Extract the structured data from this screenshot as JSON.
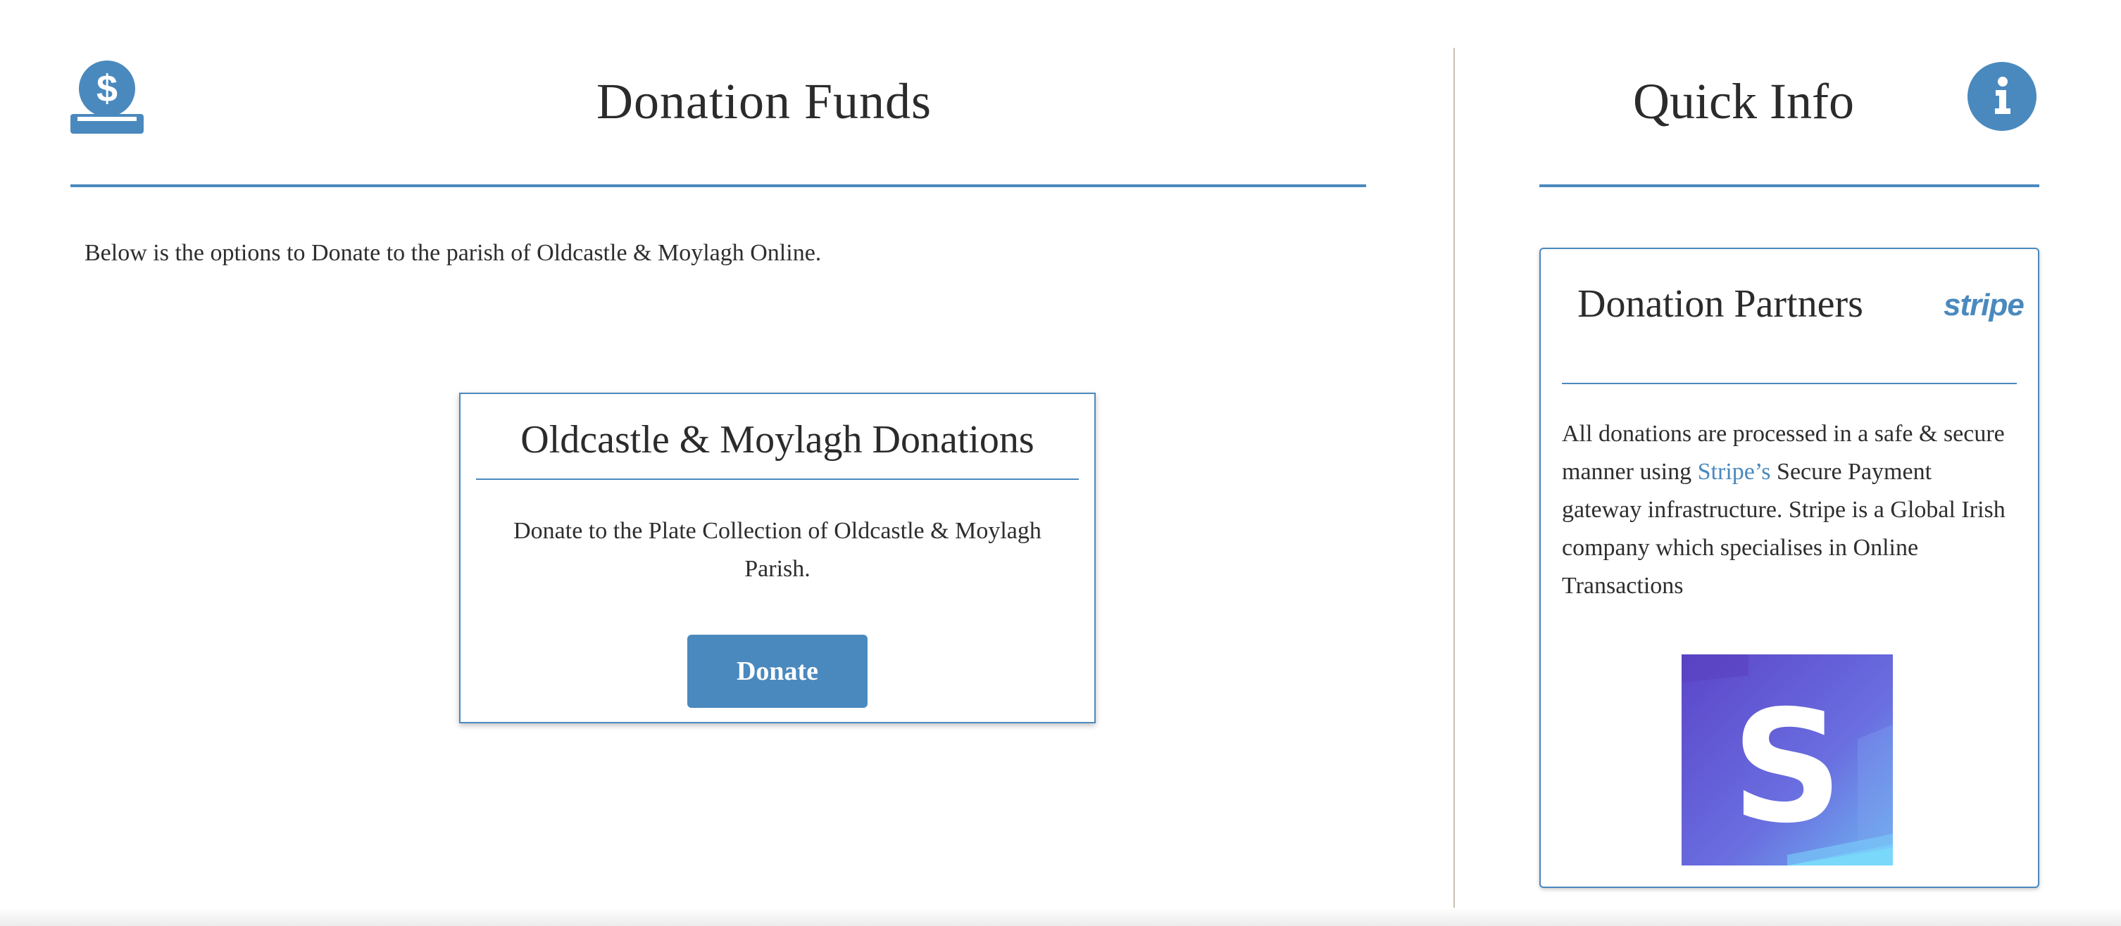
{
  "main": {
    "title": "Donation Funds",
    "intro": "Below is the options to Donate to the parish of Oldcastle & Moylagh Online.",
    "card": {
      "title": "Oldcastle & Moylagh Donations",
      "text": "Donate to the Plate Collection of Oldcastle & Moylagh Parish.",
      "button_label": "Donate"
    }
  },
  "sidebar": {
    "title": "Quick Info",
    "partners": {
      "title": "Donation Partners",
      "wordmark": "stripe",
      "text_before": "All donations are processed in a safe & secure manner using ",
      "link_text": "Stripe’s",
      "text_after": " Secure Payment gateway infrastructure. Stripe is a Global Irish company which specialises in Online Transactions",
      "logo_letter": "S"
    }
  },
  "colors": {
    "accent": "#4a89be",
    "divider": "#c9bfb2",
    "text": "#2b2b2b",
    "stripe_gradient": [
      "#5a4fd0",
      "#6a6ee0",
      "#7ad0f7"
    ]
  },
  "icons": {
    "header_left": "dollar-coin-donate-icon",
    "header_right": "info-icon"
  }
}
